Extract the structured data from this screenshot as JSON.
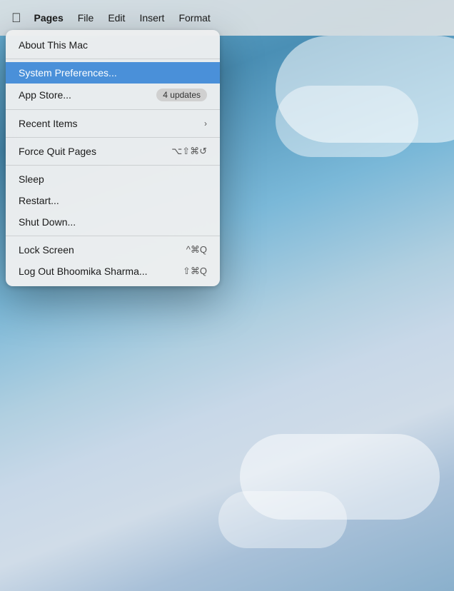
{
  "menubar": {
    "apple_icon": "🍎",
    "items": [
      {
        "label": "Pages",
        "bold": true
      },
      {
        "label": "File"
      },
      {
        "label": "Edit"
      },
      {
        "label": "Insert"
      },
      {
        "label": "Format"
      }
    ]
  },
  "apple_menu": {
    "items": [
      {
        "id": "about",
        "label": "About This Mac",
        "shortcut": "",
        "type": "normal"
      },
      {
        "type": "separator"
      },
      {
        "id": "system-prefs",
        "label": "System Preferences...",
        "shortcut": "",
        "type": "highlighted"
      },
      {
        "id": "app-store",
        "label": "App Store...",
        "shortcut": "",
        "badge": "4 updates",
        "type": "normal"
      },
      {
        "type": "separator"
      },
      {
        "id": "recent-items",
        "label": "Recent Items",
        "shortcut": "›",
        "type": "submenu"
      },
      {
        "type": "separator"
      },
      {
        "id": "force-quit",
        "label": "Force Quit Pages",
        "shortcut": "⌥⇧⌘↺",
        "type": "normal"
      },
      {
        "type": "separator"
      },
      {
        "id": "sleep",
        "label": "Sleep",
        "shortcut": "",
        "type": "normal"
      },
      {
        "id": "restart",
        "label": "Restart...",
        "shortcut": "",
        "type": "normal"
      },
      {
        "id": "shutdown",
        "label": "Shut Down...",
        "shortcut": "",
        "type": "normal"
      },
      {
        "type": "separator"
      },
      {
        "id": "lock-screen",
        "label": "Lock Screen",
        "shortcut": "^⌘Q",
        "type": "normal"
      },
      {
        "id": "logout",
        "label": "Log Out Bhoomika Sharma...",
        "shortcut": "⇧⌘Q",
        "type": "normal"
      }
    ]
  }
}
